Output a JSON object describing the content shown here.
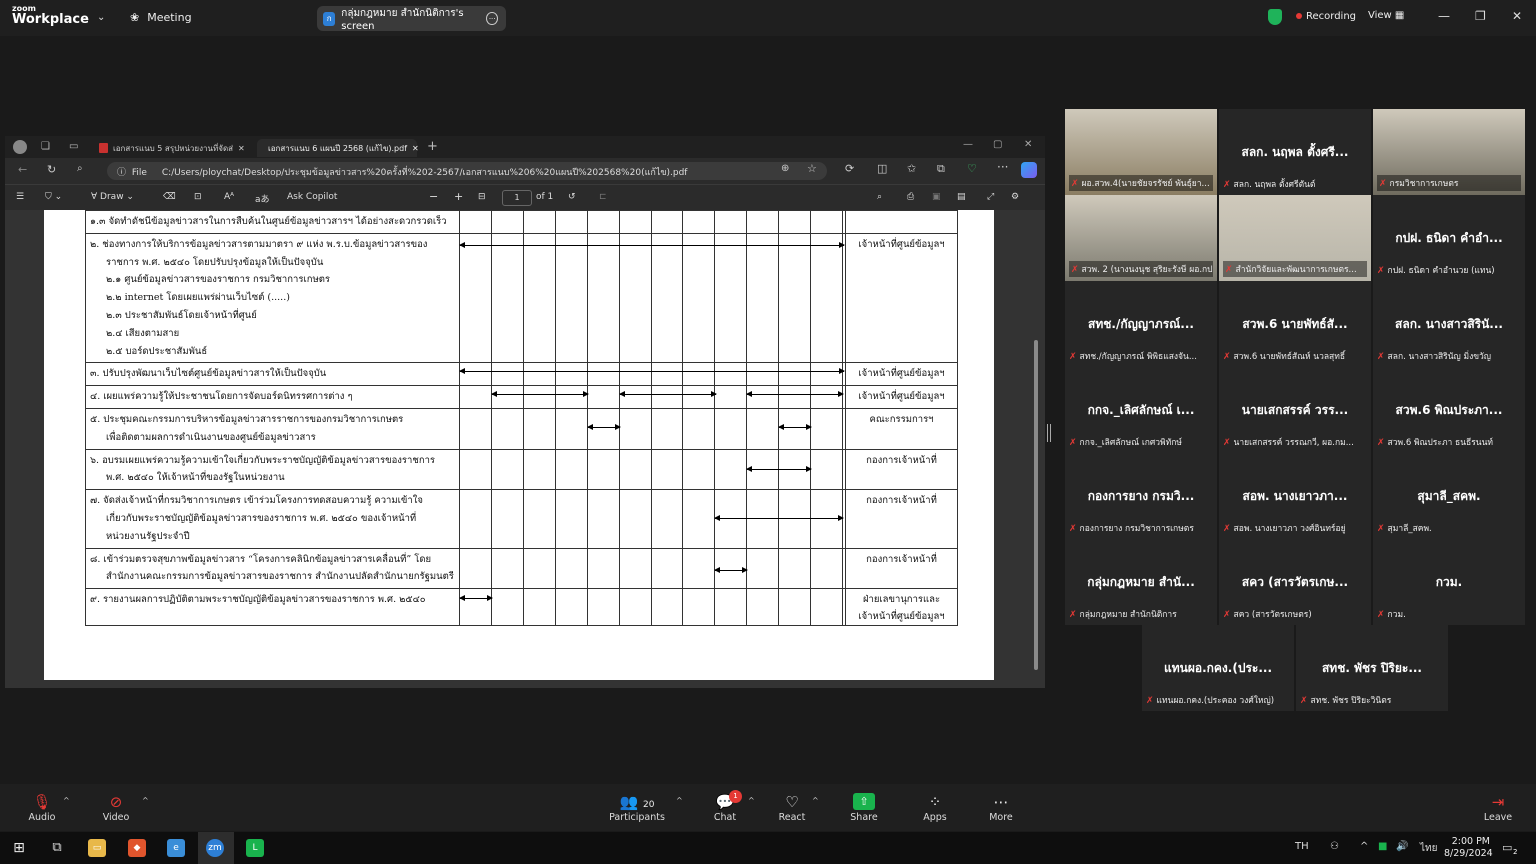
{
  "zoom": {
    "logo_line1": "zoom",
    "logo_line2": "Workplace",
    "meeting_label": "Meeting",
    "share_pill_label": "กลุ่มกฎหมาย สำนักนิติการ's screen",
    "recording_label": "Recording",
    "view_label": "View"
  },
  "edge": {
    "tabs": [
      {
        "label": "เอกสารแนบ 5 สรุปหน่วยงานที่จัดส่งข้อ..."
      },
      {
        "label": "เอกสารแนบ 6 แผนปี 2568 (แก้ไข).pdf"
      }
    ],
    "file_label": "File",
    "url": "C:/Users/ploychat/Desktop/ประชุมข้อมูลข่าวสาร%20ครั้งที่%202-2567/เอกสารแนบ%206%20แผนปี%202568%20(แก้ไข).pdf",
    "draw_label": "Draw",
    "ask_copilot_label": "Ask Copilot",
    "page_current": "1",
    "page_total": "of 1"
  },
  "document": {
    "rows": [
      {
        "lines": [
          "๑.๓ จัดทำดัชนีข้อมูลข่าวสารในการสืบค้นในศูนย์ข้อมูลข่าวสารฯ ได้อย่างสะดวกรวดเร็ว"
        ],
        "resp": "",
        "h": 20,
        "arrows": []
      },
      {
        "lines": [
          "๒. ช่องทางการให้บริการข้อมูลข่าวสารตามมาตรา ๙ แห่ง พ.ร.บ.ข้อมูลข่าวสารของ",
          "ราชการ พ.ศ. ๒๕๔๐ โดยปรับปรุงข้อมูลให้เป็นปัจจุบัน",
          "๒.๑ ศูนย์ข้อมูลข่าวสารของราชการ กรมวิชาการเกษตร",
          "๒.๒ internet โดยเผยแพร่ผ่านเว็บไซต์ (.....)",
          "๒.๓ ประชาสัมพันธ์โดยเจ้าหน้าที่ศูนย์",
          "๒.๔ เสียงตามสาย",
          "๒.๕ บอร์ดประชาสัมพันธ์"
        ],
        "resp": "เจ้าหน้าที่ศูนย์ข้อมูลฯ",
        "h": 126,
        "arrows": [
          [
            0,
            12,
            11
          ]
        ]
      },
      {
        "lines": [
          "๓. ปรับปรุงพัฒนาเว็บไซต์ศูนย์ข้อมูลข่าวสารให้เป็นปัจจุบัน"
        ],
        "resp": "เจ้าหน้าที่ศูนย์ข้อมูลฯ",
        "h": 18,
        "arrows": [
          [
            0,
            12,
            8
          ]
        ]
      },
      {
        "lines": [
          "๔. เผยแพร่ความรู้ให้ประชาชนโดยการจัดบอร์ดนิทรรศการต่าง ๆ"
        ],
        "resp": "เจ้าหน้าที่ศูนย์ข้อมูลฯ",
        "h": 18,
        "arrows": [
          [
            1,
            4,
            8
          ],
          [
            5,
            8,
            8
          ],
          [
            9,
            12,
            8
          ]
        ]
      },
      {
        "lines": [
          "๕. ประชุมคณะกรรมการบริหารข้อมูลข่าวสารราชการของกรมวิชาการเกษตร",
          "เพื่อติดตามผลการดำเนินงานของศูนย์ข้อมูลข่าวสาร"
        ],
        "resp": "คณะกรรมการฯ",
        "h": 36,
        "arrows": [
          [
            4,
            5,
            18
          ],
          [
            10,
            11,
            18
          ]
        ]
      },
      {
        "lines": [
          "๖. อบรมเผยแพร่ความรู้ความเข้าใจเกี่ยวกับพระราชบัญญัติข้อมูลข่าวสารของราชการ",
          "พ.ศ. ๒๕๔๐ ให้เจ้าหน้าที่ของรัฐในหน่วยงาน"
        ],
        "resp": "กองการเจ้าหน้าที่",
        "h": 36,
        "arrows": [
          [
            9,
            11,
            19
          ]
        ]
      },
      {
        "lines": [
          "๗. จัดส่งเจ้าหน้าที่กรมวิชาการเกษตร เข้าร่วมโครงการทดสอบความรู้ ความเข้าใจ",
          "เกี่ยวกับพระราชบัญญัติข้อมูลข่าวสารของราชการ พ.ศ. ๒๕๔๐ ของเจ้าหน้าที่",
          "หน่วยงานรัฐประจำปี"
        ],
        "resp": "กองการเจ้าหน้าที่",
        "h": 54,
        "arrows": [
          [
            8,
            12,
            28
          ]
        ]
      },
      {
        "lines": [
          "๘. เข้าร่วมตรวจสุขภาพข้อมูลข่าวสาร “โครงการคลินิกข้อมูลข่าวสารเคลื่อนที่” โดย",
          "สำนักงานคณะกรรมการข้อมูลข่าวสารของราชการ สำนักงานปลัดสำนักนายกรัฐมนตรี"
        ],
        "resp": "กองการเจ้าหน้าที่",
        "h": 36,
        "arrows": [
          [
            8,
            9,
            21
          ]
        ]
      },
      {
        "lines": [
          "๙. รายงานผลการปฏิบัติตามพระราชบัญญัติข้อมูลข่าวสารของราชการ พ.ศ. ๒๕๔๐"
        ],
        "resp": "ฝ่ายเลขานุการและ|เจ้าหน้าที่ศูนย์ข้อมูลฯ",
        "h": 36,
        "arrows": [
          [
            0,
            1,
            9
          ]
        ]
      }
    ]
  },
  "participants": [
    {
      "name": "",
      "label": "ผอ.สวพ.4(นายชัยจรรัชย์ พันธุ์ยา...",
      "video": true
    },
    {
      "name": "สลก. นฤพล ตั้งศรี...",
      "label": "สลก. นฤพล ตั้งศรีตันต์",
      "video": false
    },
    {
      "name": "",
      "label": "กรมวิชาการเกษตร",
      "video": true,
      "highlight": true
    },
    {
      "name": "",
      "label": "สวพ. 2 (นางนงนุช สุริยะรังษี ผอ.กป...",
      "video": true
    },
    {
      "name": "",
      "label": "สำนักวิจัยและพัฒนาการเกษตร...",
      "video": true
    },
    {
      "name": "กปฝ. ธนิดา คำอำ...",
      "label": "กปฝ. ธนิดา คำอำนวย (แทน)",
      "video": false
    },
    {
      "name": "สทช./กัญญาภรณ์...",
      "label": "สทช./กัญญาภรณ์ พิพิธแสงจัน...",
      "video": false
    },
    {
      "name": "สวพ.6 นายพัทธ์สั...",
      "label": "สวพ.6 นายพัทธ์สัณห์ นวลสุทธิ์",
      "video": false
    },
    {
      "name": "สลก. นางสาวสิรินั...",
      "label": "สลก. นางสาวสิรินัญ มิ่งขวัญ",
      "video": false
    },
    {
      "name": "กกจ._เลิศลักษณ์ เ...",
      "label": "กกจ._เลิศลักษณ์ เกศวพิทักษ์",
      "video": false
    },
    {
      "name": "นายเสกสรรค์ วรร...",
      "label": "นายเสกสรรค์ วรรณกวี, ผอ.กม...",
      "video": false
    },
    {
      "name": "สวพ.6 พิณประภา...",
      "label": "สวพ.6 พิณประภา ธนธีรนนท์",
      "video": false
    },
    {
      "name": "กองการยาง กรมวิ...",
      "label": "กองการยาง กรมวิชาการเกษตร",
      "video": false
    },
    {
      "name": "สอพ. นางเยาวภา...",
      "label": "สอพ. นางเยาวภา วงศ์อินทร์อยู่",
      "video": false
    },
    {
      "name": "สุมาลี_สคพ.",
      "label": "สุมาลี_สคพ.",
      "video": false
    },
    {
      "name": "กลุ่มกฎหมาย สำนั...",
      "label": "กลุ่มกฎหมาย สำนักนิติการ",
      "video": false
    },
    {
      "name": "สคว (สารวัตรเกษ...",
      "label": "สคว (สารวัตรเกษตร)",
      "video": false
    },
    {
      "name": "กวม.",
      "label": "กวม.",
      "video": false
    },
    {
      "name": "แทนผอ.กคง.(ประ...",
      "label": "แทนผอ.กคง.(ประคอง วงศ์ใหญ่)",
      "video": false
    },
    {
      "name": "สทช. พัชร ปิริยะ...",
      "label": "สทช. พัชร ปิริยะวินิตร",
      "video": false
    }
  ],
  "toolbar": {
    "audio_label": "Audio",
    "video_label": "Video",
    "participants_label": "Participants",
    "participants_count": "20",
    "chat_label": "Chat",
    "chat_badge": "1",
    "react_label": "React",
    "share_label": "Share",
    "apps_label": "Apps",
    "more_label": "More",
    "leave_label": "Leave"
  },
  "taskbar": {
    "lang": "TH",
    "ime": "ไทย",
    "time": "2:00 PM",
    "date": "8/29/2024",
    "notif_count": "2"
  }
}
